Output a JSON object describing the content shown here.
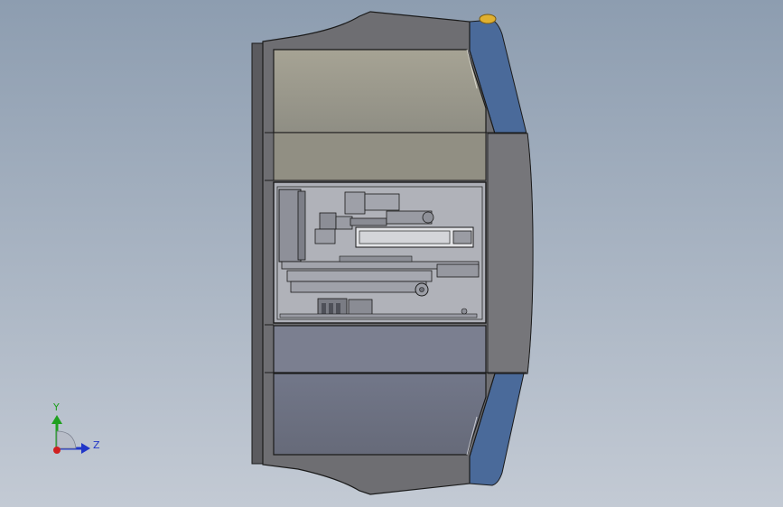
{
  "viewport": {
    "background_top": "#8d9db0",
    "background_bottom": "#c3cad4"
  },
  "model": {
    "shell_color": "#6e6e72",
    "edge_color": "#1a1a1a",
    "top_window_color": "#9c9a8c",
    "lower_panel_color": "#7b7f90",
    "bottom_window_color": "#6c7080",
    "bay_color": "#aeb0b8",
    "blue_trim_color": "#4a6a9a",
    "knob_color": "#e0b030"
  },
  "triad": {
    "y_label": "Y",
    "z_label": "Z",
    "y_axis_color": "#1fa01f",
    "z_axis_color": "#2036c8",
    "x_axis_color": "#d02020"
  }
}
